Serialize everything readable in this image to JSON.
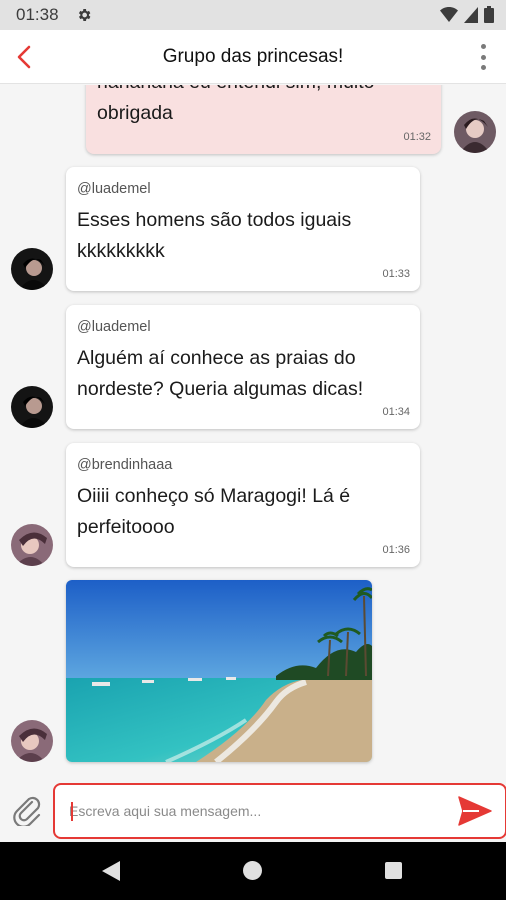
{
  "status_bar": {
    "time": "01:38",
    "icons": [
      "gear-icon",
      "wifi-icon",
      "signal-icon",
      "battery-icon"
    ]
  },
  "header": {
    "title": "Grupo das princesas!",
    "back_icon": "arrow-left-icon",
    "menu_icon": "more-vert-icon"
  },
  "messages": [
    {
      "type": "out",
      "text": "hahahaha eu entendi sim, muito obrigada",
      "time": "01:32"
    },
    {
      "type": "in",
      "author": "@luademel",
      "text": "Esses homens são todos iguais kkkkkkkkk",
      "time": "01:33"
    },
    {
      "type": "in",
      "author": "@luademel",
      "text": "Alguém aí conhece as praias do nordeste? Queria algumas dicas!",
      "time": "01:34"
    },
    {
      "type": "in",
      "author": "@brendinhaaa",
      "text": "Oiiii conheço só Maragogi! Lá é perfeitoooo",
      "time": "01:36"
    },
    {
      "type": "image",
      "content": "beach-photo"
    }
  ],
  "composer": {
    "placeholder": "Escreva aqui sua mensagem...",
    "attach_icon": "paperclip-icon",
    "send_icon": "send-icon"
  },
  "colors": {
    "accent": "#e53935",
    "outgoing_bubble": "#f9e0e0",
    "incoming_bubble": "#ffffff"
  }
}
